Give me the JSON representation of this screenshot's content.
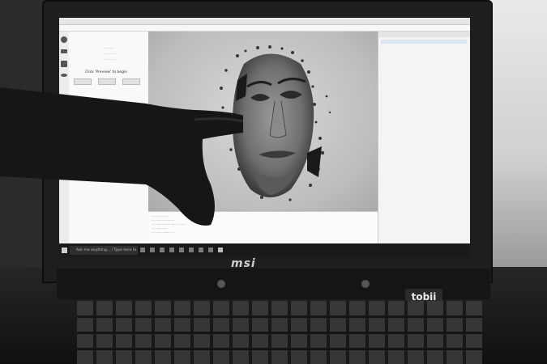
{
  "screen": {
    "left_panel": {
      "prompt": "Click 'Preview' to begin",
      "buttons": [
        "",
        "",
        ""
      ]
    },
    "taskbar": {
      "search_placeholder": "Ask me anything... / Type here to search"
    }
  },
  "laptop": {
    "brand": "msi",
    "sticker": "tobii"
  },
  "icons": [
    "windows-start-icon",
    "search-icon",
    "taskbar-app-icon",
    "fingerprint-icon",
    "hand-icon"
  ]
}
